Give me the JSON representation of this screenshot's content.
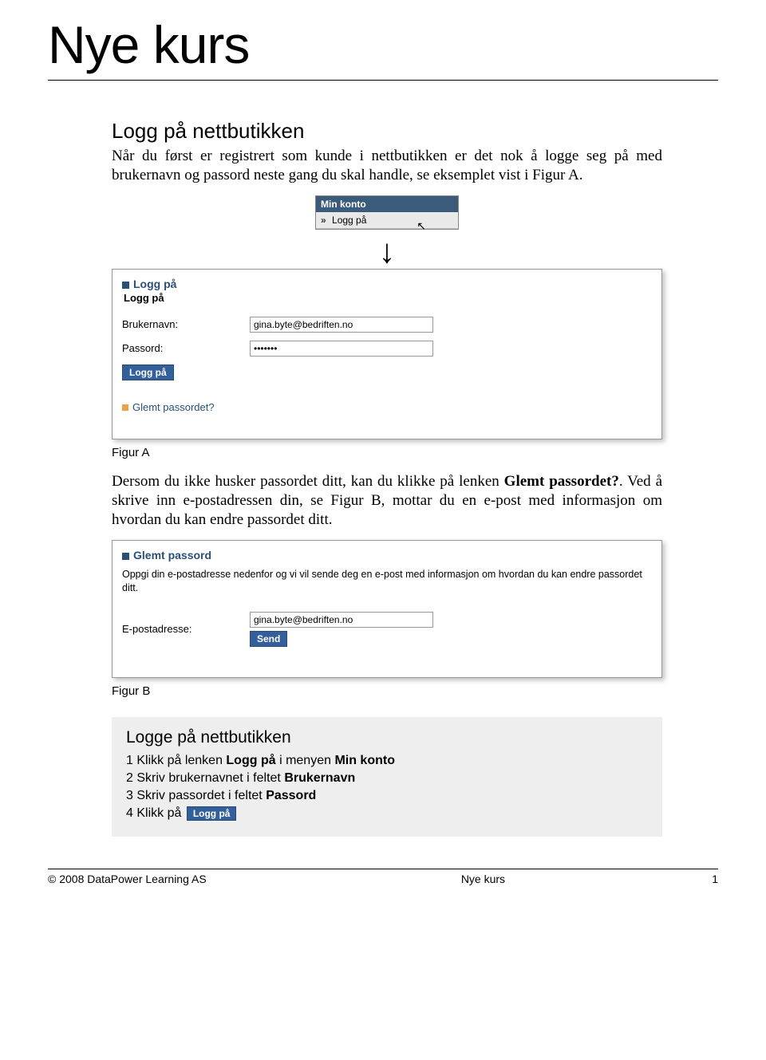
{
  "title": "Nye kurs",
  "section_heading": "Logg på nettbutikken",
  "intro_text": "Når du først er registrert som kunde i nettbutikken er det nok å logge seg på med brukernavn og passord neste gang du skal handle, se eksemplet vist i Figur A.",
  "figA": {
    "minkonto_header": "Min konto",
    "minkonto_item": "Logg på",
    "panel_title": "Logg på",
    "panel_sub": "Logg på",
    "username_label": "Brukernavn:",
    "username_value": "gina.byte@bedriften.no",
    "password_label": "Passord:",
    "password_value": "•••••••",
    "login_button": "Logg på",
    "forgot_text": "Glemt passordet?",
    "caption": "Figur A"
  },
  "mid_text_pre": "Dersom du ikke husker passordet ditt, kan du klikke på lenken ",
  "mid_text_bold": "Glemt passordet?",
  "mid_text_post": ". Ved å skrive inn e-postadressen din, se Figur B, mottar du en e-post med informasjon om hvordan du kan endre passordet ditt.",
  "figB": {
    "panel_title": "Glemt passord",
    "desc": "Oppgi din e-postadresse nedenfor og vi vil sende deg en e-post med informasjon om hvordan du kan endre passordet ditt.",
    "email_label": "E-postadresse:",
    "email_value": "gina.byte@bedriften.no",
    "send_button": "Send",
    "caption": "Figur B"
  },
  "steps": {
    "title": "Logge på nettbutikken",
    "s1_pre": "1  Klikk på lenken ",
    "s1_b1": "Logg på",
    "s1_mid": " i menyen ",
    "s1_b2": "Min konto",
    "s2_pre": "2  Skriv brukernavnet i feltet ",
    "s2_b": "Brukernavn",
    "s3_pre": "3  Skriv passordet i feltet ",
    "s3_b": "Passord",
    "s4_pre": "4  Klikk på ",
    "s4_btn": "Logg på"
  },
  "footer": {
    "left": "© 2008 DataPower Learning AS",
    "mid": "Nye kurs",
    "right": "1"
  }
}
